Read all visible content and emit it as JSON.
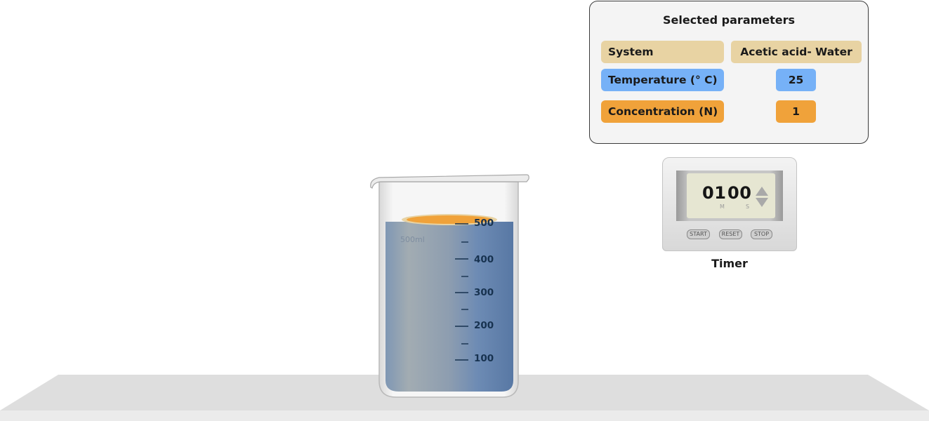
{
  "parameters": {
    "title": "Selected parameters",
    "system_label": "System",
    "system_value": "Acetic acid- Water",
    "temperature_label": "Temperature (° C)",
    "temperature_value": "25",
    "concentration_label": "Concentration (N)",
    "concentration_value": "1"
  },
  "timer": {
    "minutes": "01",
    "seconds": "00",
    "minute_unit": "M",
    "second_unit": "S",
    "start_label": "START",
    "reset_label": "RESET",
    "stop_label": "STOP",
    "caption": "Timer"
  },
  "beaker": {
    "brand_label": "500ml",
    "graduations": [
      "500",
      "400",
      "300",
      "200",
      "100"
    ],
    "liquid_color": "#6f8fb8",
    "surface_color": "#f0a23a"
  },
  "colors": {
    "system": "#e8d3a3",
    "temperature": "#76b1f7",
    "concentration": "#f0a23a"
  }
}
